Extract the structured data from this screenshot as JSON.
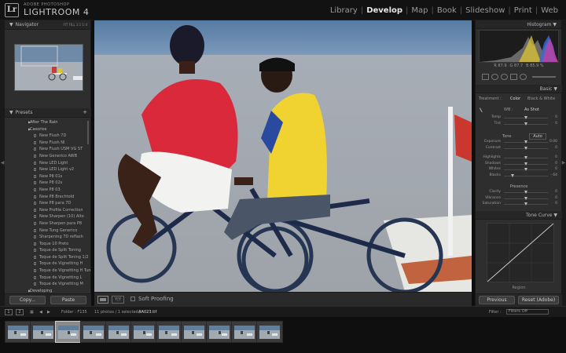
{
  "app": {
    "brand_small": "ADOBE PHOTOSHOP",
    "brand_big": "LIGHTROOM 4",
    "logo": "Lr"
  },
  "modules": [
    "Library",
    "Develop",
    "Map",
    "Book",
    "Slideshow",
    "Print",
    "Web"
  ],
  "active_module": "Develop",
  "navigator": {
    "title": "Navigator",
    "options": "FIT  FILL  1:1  1:4"
  },
  "presets": {
    "title": "Presets",
    "rows": [
      {
        "type": "folder",
        "label": "After The Rain"
      },
      {
        "type": "folder",
        "label": "Casorios"
      },
      {
        "type": "item",
        "label": "New Flush 7D"
      },
      {
        "type": "item",
        "label": "New Flush NI"
      },
      {
        "type": "item",
        "label": "New Flush USM VG ST"
      },
      {
        "type": "item",
        "label": "New Generico AWB"
      },
      {
        "type": "item",
        "label": "New LED Light"
      },
      {
        "type": "item",
        "label": "New LED Light v2"
      },
      {
        "type": "item",
        "label": "New P8 01s"
      },
      {
        "type": "item",
        "label": "New P8 02s"
      },
      {
        "type": "item",
        "label": "New P8 03"
      },
      {
        "type": "item",
        "label": "New P8 Brechtold"
      },
      {
        "type": "item",
        "label": "New P8 para 7D"
      },
      {
        "type": "item",
        "label": "New Profile Correction"
      },
      {
        "type": "item",
        "label": "New Sharpen (10) Alto"
      },
      {
        "type": "item",
        "label": "New Sharpen para P8"
      },
      {
        "type": "item",
        "label": "New Tung Generico"
      },
      {
        "type": "item",
        "label": "Sharpening 7D reflash"
      },
      {
        "type": "item",
        "label": "Toque 10 Preto"
      },
      {
        "type": "item",
        "label": "Toque de Split Toning"
      },
      {
        "type": "item",
        "label": "Toque de Split Toning 1/2"
      },
      {
        "type": "item",
        "label": "Toque de Vignetting H"
      },
      {
        "type": "item",
        "label": "Toque de Vignetting H Tunel"
      },
      {
        "type": "item",
        "label": "Toque de Vignetting L"
      },
      {
        "type": "item",
        "label": "Toque de Vignetting M"
      },
      {
        "type": "folder",
        "label": "Developing"
      }
    ]
  },
  "left_buttons": {
    "copy": "Copy...",
    "paste": "Paste"
  },
  "toolbar": {
    "soft_proofing": "Soft Proofing",
    "view_yy": "Y|Y"
  },
  "histogram": {
    "title": "Histogram",
    "values": [
      "R  87.9",
      "G  87.7",
      "B  85.9 %"
    ]
  },
  "basic": {
    "title": "Basic",
    "treatment_label": "Treatment :",
    "treatment_color": "Color",
    "treatment_bw": "Black & White",
    "wb_label": "WB :",
    "wb_value": "As Shot",
    "tone_label": "Tone",
    "tone_auto": "Auto",
    "presence_label": "Presence",
    "sliders": [
      {
        "label": "Temp",
        "value": "0",
        "pos": 0.5,
        "group": "wb"
      },
      {
        "label": "Tint",
        "value": "0",
        "pos": 0.5,
        "group": "wb"
      },
      {
        "label": "Exposure",
        "value": "0.00",
        "pos": 0.5,
        "group": "tone"
      },
      {
        "label": "Contrast",
        "value": "0",
        "pos": 0.5,
        "group": "tone"
      },
      {
        "label": "Highlights",
        "value": "0",
        "pos": 0.5,
        "group": "tone2"
      },
      {
        "label": "Shadows",
        "value": "0",
        "pos": 0.5,
        "group": "tone2"
      },
      {
        "label": "Whites",
        "value": "0",
        "pos": 0.5,
        "group": "tone2"
      },
      {
        "label": "Blacks",
        "value": "- 64",
        "pos": 0.2,
        "group": "tone2"
      },
      {
        "label": "Clarity",
        "value": "0",
        "pos": 0.5,
        "group": "presence"
      },
      {
        "label": "Vibrance",
        "value": "0",
        "pos": 0.5,
        "group": "presence"
      },
      {
        "label": "Saturation",
        "value": "0",
        "pos": 0.5,
        "group": "presence"
      }
    ]
  },
  "tone_curve": {
    "title": "Tone Curve",
    "region_label": "Region"
  },
  "right_buttons": {
    "previous": "Previous",
    "reset": "Reset (Adobe)"
  },
  "filmbar": {
    "screen1": "1",
    "screen2": "2",
    "folder_label": "Folder : F135",
    "count_label": "11 photos / 1 selected /",
    "file_name": "AA023.tif",
    "filter_label": "Filter :",
    "filter_value": "Filters Off"
  },
  "filmstrip": {
    "count": 11,
    "selected_index": 2
  },
  "colors": {
    "panel": "#2e2e2e",
    "accent": "#e8e8e8",
    "background": "#0e0e0e"
  }
}
